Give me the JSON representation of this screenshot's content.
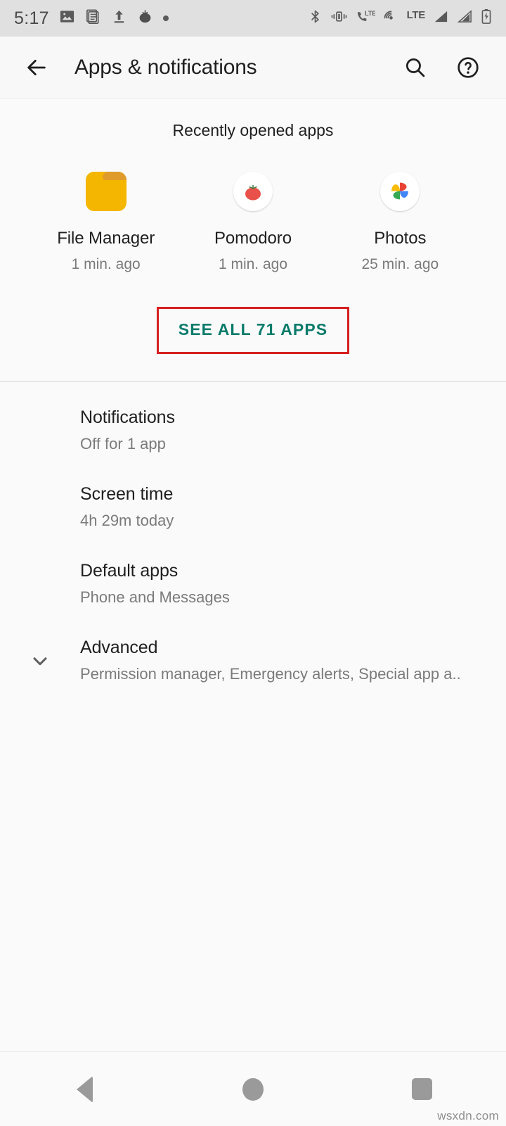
{
  "status_bar": {
    "clock": "5:17",
    "left_icons": [
      "image-icon",
      "document-icon",
      "upload-icon",
      "tomato-icon",
      "dot-icon"
    ],
    "right_icons": [
      "bluetooth-icon",
      "vibrate-icon",
      "volte-call-icon",
      "hotspot-icon",
      "lte-label",
      "signal-bars-icon",
      "signal-bars-2-icon",
      "battery-charging-icon"
    ],
    "lte_label": "LTE",
    "volte_label": "LTE",
    "background": "#e0e0e0"
  },
  "toolbar": {
    "back_icon": "back-arrow-icon",
    "title": "Apps & notifications",
    "search_icon": "search-icon",
    "help_icon": "help-circle-icon"
  },
  "recent": {
    "heading": "Recently opened apps",
    "apps": [
      {
        "name": "File Manager",
        "time": "1 min. ago",
        "icon": "file-manager-folder-icon"
      },
      {
        "name": "Pomodoro",
        "time": "1 min. ago",
        "icon": "pomodoro-tomato-icon"
      },
      {
        "name": "Photos",
        "time": "25 min. ago",
        "icon": "google-photos-icon"
      }
    ],
    "see_all_label": "SEE ALL 71 APPS",
    "see_all_color": "#0a7b6b",
    "highlight_color": "#d62020"
  },
  "settings": {
    "items": [
      {
        "title": "Notifications",
        "subtitle": "Off for 1 app",
        "leading_icon": ""
      },
      {
        "title": "Screen time",
        "subtitle": "4h 29m today",
        "leading_icon": ""
      },
      {
        "title": "Default apps",
        "subtitle": "Phone and Messages",
        "leading_icon": ""
      },
      {
        "title": "Advanced",
        "subtitle": "Permission manager, Emergency alerts, Special app a..",
        "leading_icon": "chevron-down-icon"
      }
    ]
  },
  "nav_bar": {
    "back_icon": "nav-back-triangle-icon",
    "home_icon": "nav-home-circle-icon",
    "recents_icon": "nav-recents-square-icon"
  },
  "watermark": "wsxdn.com"
}
